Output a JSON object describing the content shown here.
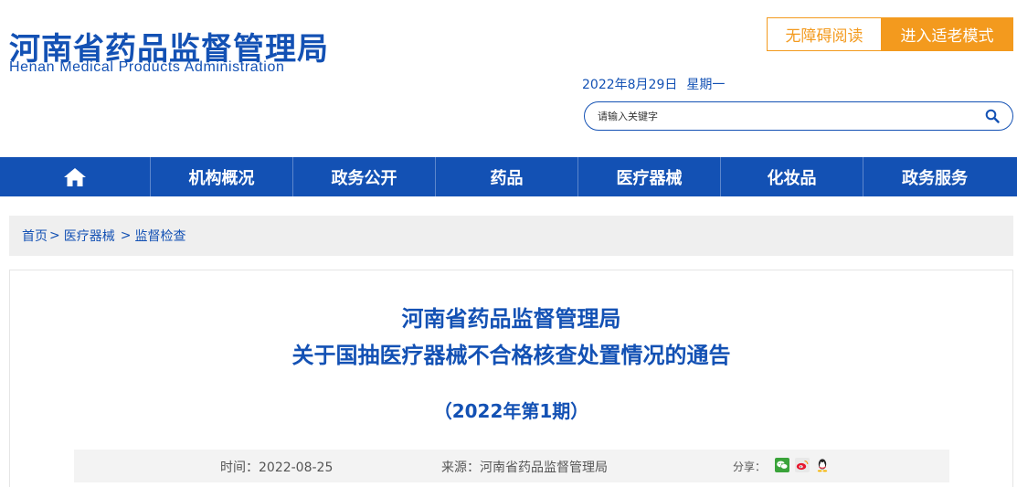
{
  "header": {
    "logo_cn": "河南省药品监督管理局",
    "logo_en": "Henan Medical Products Administration",
    "accessibility_label": "无障碍阅读",
    "elder_mode_label": "进入适老模式",
    "date": "2022年8月29日",
    "weekday": "星期一",
    "search": {
      "placeholder": "请输入关键字"
    }
  },
  "nav": {
    "home_icon": "home-icon",
    "items": [
      "机构概况",
      "政务公开",
      "药品",
      "医疗器械",
      "化妆品",
      "政务服务"
    ]
  },
  "breadcrumb": {
    "items": [
      "首页",
      "医疗器械",
      "监督检查"
    ],
    "separators": [
      ">",
      ">"
    ]
  },
  "article": {
    "title_line1": "河南省药品监督管理局",
    "title_line2": "关于国抽医疗器械不合格核查处置情况的通告",
    "subtitle": "（2022年第1期）",
    "time_label": "时间：",
    "time_value": "2022-08-25",
    "source_label": "来源：",
    "source_value": "河南省药品监督管理局",
    "share_label": "分享：",
    "share_icons": [
      "wechat-icon",
      "weibo-icon",
      "qq-icon"
    ]
  },
  "colors": {
    "brand_blue": "#1351b4",
    "accent_orange": "#f39a1e"
  }
}
